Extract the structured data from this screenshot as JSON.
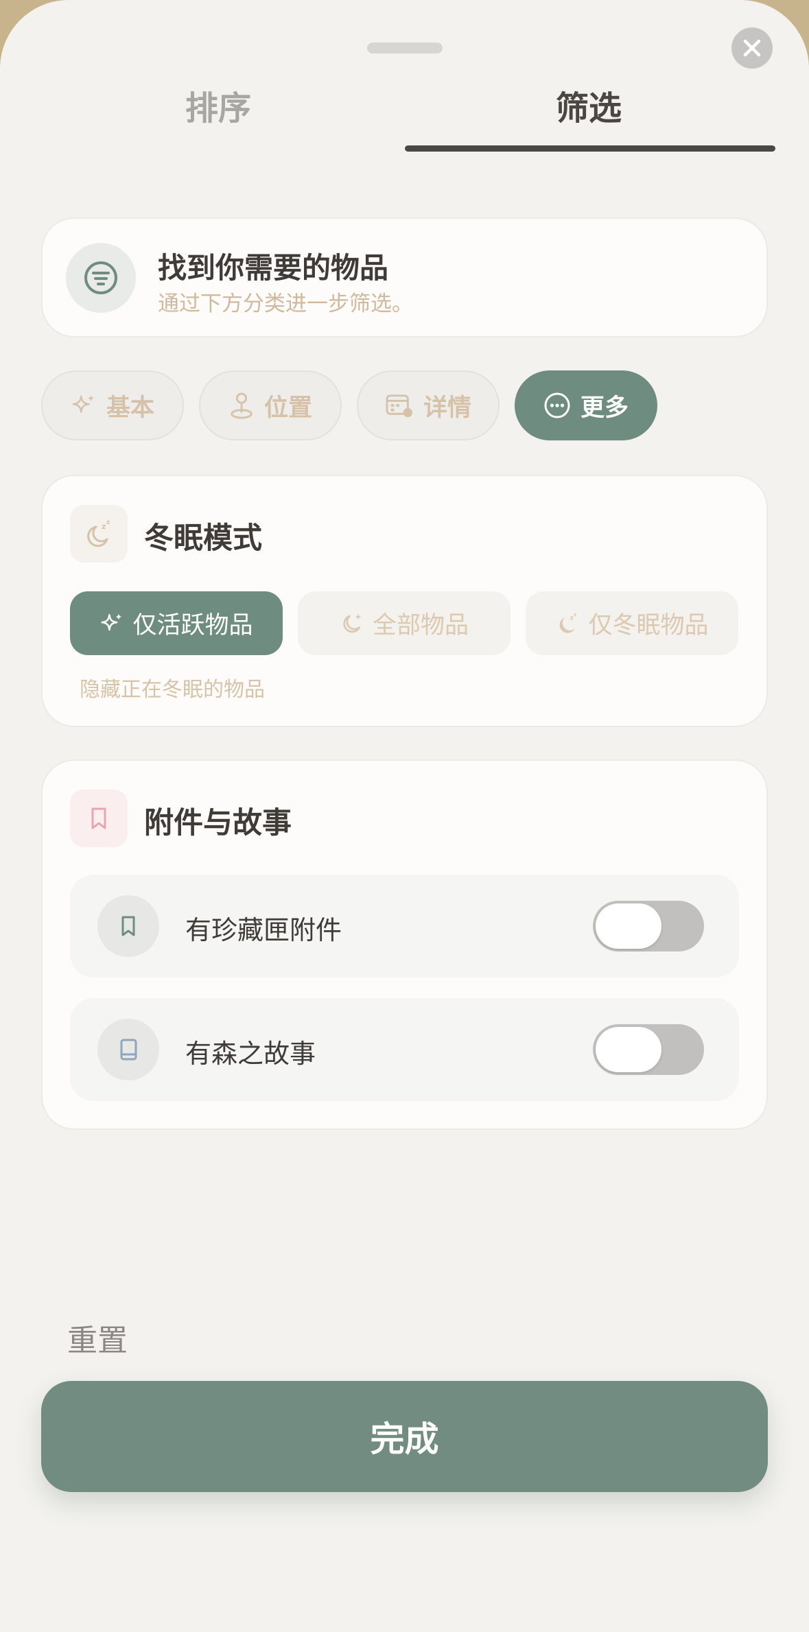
{
  "tabs": {
    "sort_label": "排序",
    "filter_label": "筛选",
    "active": "筛选"
  },
  "intro": {
    "title": "找到你需要的物品",
    "subtitle": "通过下方分类进一步筛选。",
    "icon": "filter-lines-icon"
  },
  "categories": [
    {
      "label": "基本",
      "icon": "sparkles-icon",
      "selected": false
    },
    {
      "label": "位置",
      "icon": "map-pin-icon",
      "selected": false
    },
    {
      "label": "详情",
      "icon": "calendar-detail-icon",
      "selected": false
    },
    {
      "label": "更多",
      "icon": "more-dots-icon",
      "selected": true
    }
  ],
  "hibernation": {
    "title": "冬眠模式",
    "icon": "sleeping-moon-icon",
    "options": [
      {
        "label": "仅活跃物品",
        "icon": "sparkles-icon",
        "selected": true
      },
      {
        "label": "全部物品",
        "icon": "moon-sparkle-icon",
        "selected": false
      },
      {
        "label": "仅冬眠物品",
        "icon": "moon-sleep-icon",
        "selected": false
      }
    ],
    "hint": "隐藏正在冬眠的物品"
  },
  "attachments": {
    "title": "附件与故事",
    "icon": "bookmark-icon",
    "rows": [
      {
        "label": "有珍藏匣附件",
        "icon": "bookmark-icon",
        "enabled": false
      },
      {
        "label": "有森之故事",
        "icon": "book-icon",
        "enabled": false
      }
    ]
  },
  "footer": {
    "reset_label": "重置",
    "done_label": "完成"
  },
  "colors": {
    "accent": "#6f8c80",
    "background": "#f3f2ee",
    "muted_text": "#d0b99c",
    "title_text": "#3f3b37"
  }
}
